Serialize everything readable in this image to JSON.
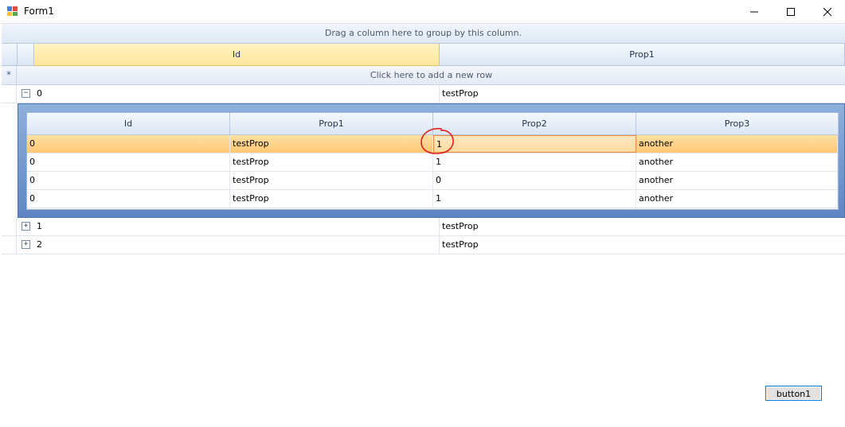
{
  "window": {
    "title": "Form1"
  },
  "grid": {
    "group_panel_text": "Drag a column here to group by this column.",
    "columns": [
      "Id",
      "Prop1"
    ],
    "new_row_text": "Click here to add a new row",
    "new_row_marker": "*",
    "rows": [
      {
        "id": "0",
        "prop1": "testProp",
        "expander": "−"
      },
      {
        "id": "1",
        "prop1": "testProp",
        "expander": "+"
      },
      {
        "id": "2",
        "prop1": "testProp",
        "expander": "+"
      }
    ],
    "child": {
      "columns": [
        "Id",
        "Prop1",
        "Prop2",
        "Prop3"
      ],
      "rows": [
        [
          "0",
          "testProp",
          "1",
          "another"
        ],
        [
          "0",
          "testProp",
          "1",
          "another"
        ],
        [
          "0",
          "testProp",
          "0",
          "another"
        ],
        [
          "0",
          "testProp",
          "1",
          "another"
        ]
      ]
    }
  },
  "buttons": {
    "button1": "button1"
  },
  "colors": {
    "accent": "#0078d7",
    "selection": "#fdc873",
    "annotation": "#e02020"
  }
}
